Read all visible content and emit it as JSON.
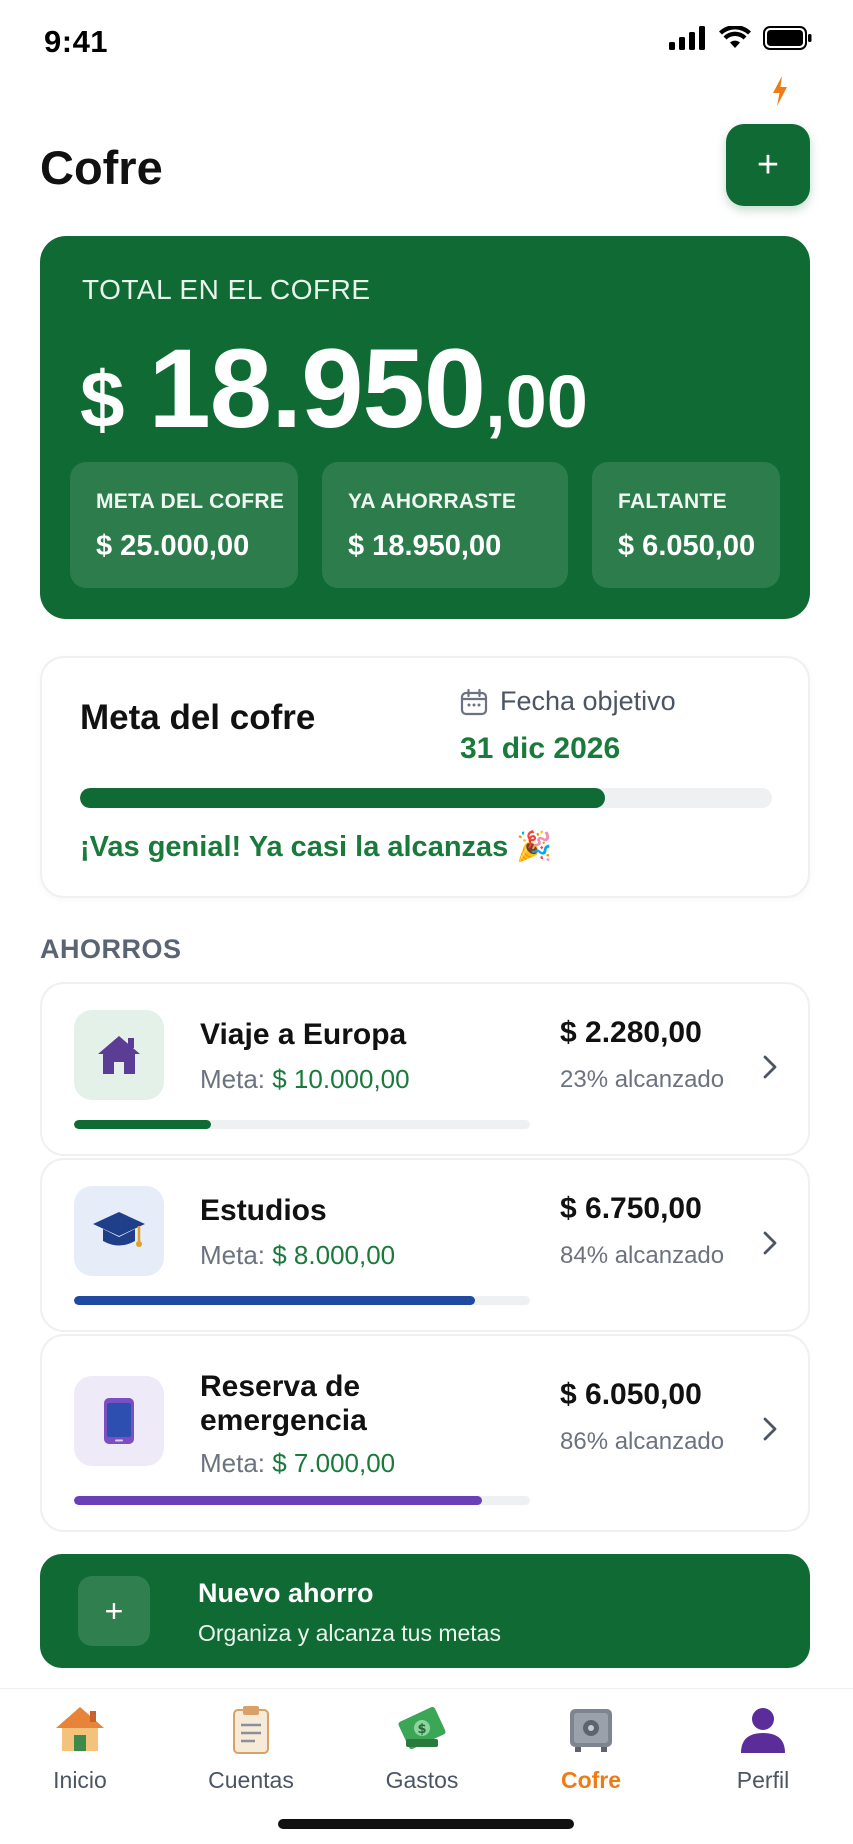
{
  "status_bar": {
    "time": "9:41"
  },
  "header": {
    "title": "Cofre",
    "add_label": "+"
  },
  "total": {
    "label": "TOTAL EN EL COFRE",
    "currency": "$",
    "amount_main": "18.950",
    "amount_cents": ",00",
    "stats": [
      {
        "label": "META DEL COFRE",
        "value": "$ 25.000,00"
      },
      {
        "label": "YA AHORRASTE",
        "value": "$ 18.950,00"
      },
      {
        "label": "FALTANTE",
        "value": "$ 6.050,00"
      }
    ]
  },
  "goal": {
    "title": "Meta del cofre",
    "date_label": "Fecha objetivo",
    "date_value": "31 dic 2026",
    "progress": 0.758,
    "message": "¡Vas genial! Ya casi la alcanzas 🎉"
  },
  "savings": {
    "section_title": "AHORROS",
    "items": [
      {
        "name": "Viaje a Europa",
        "goal_prefix": "Meta: ",
        "goal_amount": "$ 10.000,00",
        "amount": "$ 2.280,00",
        "percent_text": "23% alcanzado",
        "progress": 0.3,
        "color": "#0f6b33",
        "icon": "house-icon"
      },
      {
        "name": "Estudios",
        "goal_prefix": "Meta: ",
        "goal_amount": "$ 8.000,00",
        "amount": "$ 6.750,00",
        "percent_text": "84% alcanzado",
        "progress": 0.88,
        "color": "#1f4aa0",
        "icon": "graduation-cap-icon"
      },
      {
        "name": "Reserva de emergencia",
        "goal_prefix": "Meta: ",
        "goal_amount": "$ 7.000,00",
        "amount": "$ 6.050,00",
        "percent_text": "86% alcanzado",
        "progress": 0.895,
        "color": "#6b3fb5",
        "icon": "phone-icon"
      }
    ]
  },
  "new_saving": {
    "plus": "+",
    "title": "Nuevo ahorro",
    "subtitle": "Organiza y alcanza tus metas"
  },
  "nav": {
    "items": [
      {
        "label": "Inicio",
        "icon": "home-icon"
      },
      {
        "label": "Cuentas",
        "icon": "clipboard-icon"
      },
      {
        "label": "Gastos",
        "icon": "money-icon"
      },
      {
        "label": "Cofre",
        "icon": "safe-icon",
        "active": true
      },
      {
        "label": "Perfil",
        "icon": "user-icon"
      }
    ]
  },
  "colors": {
    "primary": "#0f6b33",
    "accent": "#f07b14",
    "text_green": "#1a7a3c"
  }
}
